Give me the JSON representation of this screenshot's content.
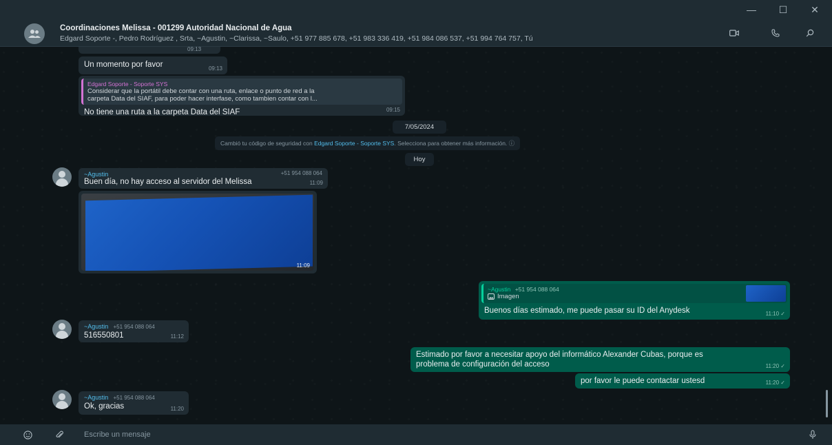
{
  "window": {
    "minimize": "—",
    "maximize": "☐",
    "close": "✕"
  },
  "header": {
    "title": "Coordinaciones Melissa - 001299 Autoridad Nacional de Agua",
    "members": "Edgard Soporte -, Pedro Rodríguez , Srta, ~Agustin, ~Clarissa, ~Saulo, +51 977 885 678, +51 983 336 419, +51 984 086 537, +51 994 764 757, Tú",
    "icons": [
      "video-icon",
      "phone-icon",
      "search-icon"
    ]
  },
  "messages": {
    "m0_time": "09:13",
    "m1": {
      "text": "Un momento por favor",
      "time": "09:13"
    },
    "m2": {
      "quote_sender": "Edgard Soporte - Soporte SYS",
      "quote_line1": "Considerar que la portátil debe contar con una ruta, enlace o punto de red a la",
      "quote_line2": "carpeta Data del SIAF, para poder hacer interfase, como tambien contar con l...",
      "text": "No tiene una ruta a la carpeta Data del SIAF",
      "time": "09:15"
    },
    "date_pill": "7/05/2024",
    "system": {
      "prefix": "Cambió tu código de seguridad con ",
      "link": "Edgard Soporte - Soporte SYS",
      "suffix": ". Selecciona para obtener más información. ⓘ"
    },
    "today_pill": "Hoy",
    "m3": {
      "sender": "~Agustin",
      "phone": "+51 954 088 064",
      "text": "Buen día, no hay acceso al servidor del Melissa",
      "time": "11:09"
    },
    "m4": {
      "time": "11:09"
    },
    "m5": {
      "quote_sender": "~Agustin",
      "quote_phone": "+51 954 088 064",
      "quote_label": "Imagen",
      "text": "Buenos días estimado, me puede pasar su ID del Anydesk",
      "time": "11:10 ✓"
    },
    "m6": {
      "sender": "~Agustin",
      "phone": "+51 954 088 064",
      "text": "516550801",
      "time": "11:12"
    },
    "m7": {
      "line1": "Estimado por favor a necesitar apoyo del informático Alexander Cubas, porque es",
      "line2": "problema de configuración del acceso",
      "time": "11:20 ✓"
    },
    "m8": {
      "text": "por favor le puede contactar ustesd",
      "time": "11:20 ✓"
    },
    "m9": {
      "sender": "~Agustin",
      "phone": "+51 954 088 064",
      "text": "Ok, gracias",
      "time": "11:20"
    }
  },
  "input": {
    "placeholder": "Escribe un mensaje"
  }
}
